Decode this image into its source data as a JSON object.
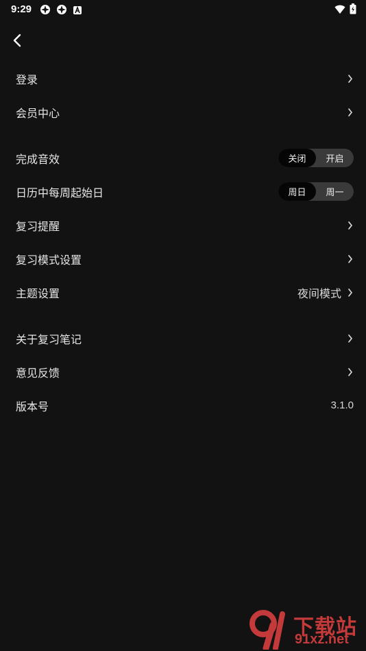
{
  "status": {
    "time": "9:29",
    "left_icons": [
      "app-icon-1",
      "app-icon-2",
      "app-icon-a"
    ],
    "right_icons": [
      "wifi-icon",
      "battery-icon"
    ]
  },
  "nav": {
    "back_icon": "chevron-left-icon"
  },
  "rows": {
    "login": {
      "label": "登录"
    },
    "vip": {
      "label": "会员中心"
    },
    "sound": {
      "label": "完成音效",
      "options": [
        "关闭",
        "开启"
      ],
      "selected": "关闭"
    },
    "week_start": {
      "label": "日历中每周起始日",
      "options": [
        "周日",
        "周一"
      ],
      "selected": "周日"
    },
    "reminder": {
      "label": "复习提醒"
    },
    "review_mode": {
      "label": "复习模式设置"
    },
    "theme": {
      "label": "主题设置",
      "value": "夜间模式"
    },
    "about": {
      "label": "关于复习笔记"
    },
    "feedback": {
      "label": "意见反馈"
    },
    "version": {
      "label": "版本号",
      "value": "3.1.0"
    }
  },
  "watermark": {
    "brand_top": "下载站",
    "brand_bottom": "91xz.net"
  },
  "colors": {
    "background": "#121212",
    "text": "#e6e6e6",
    "segment_track": "#3a3a3a",
    "segment_active": "#050505",
    "watermark": "#c43a3a"
  }
}
